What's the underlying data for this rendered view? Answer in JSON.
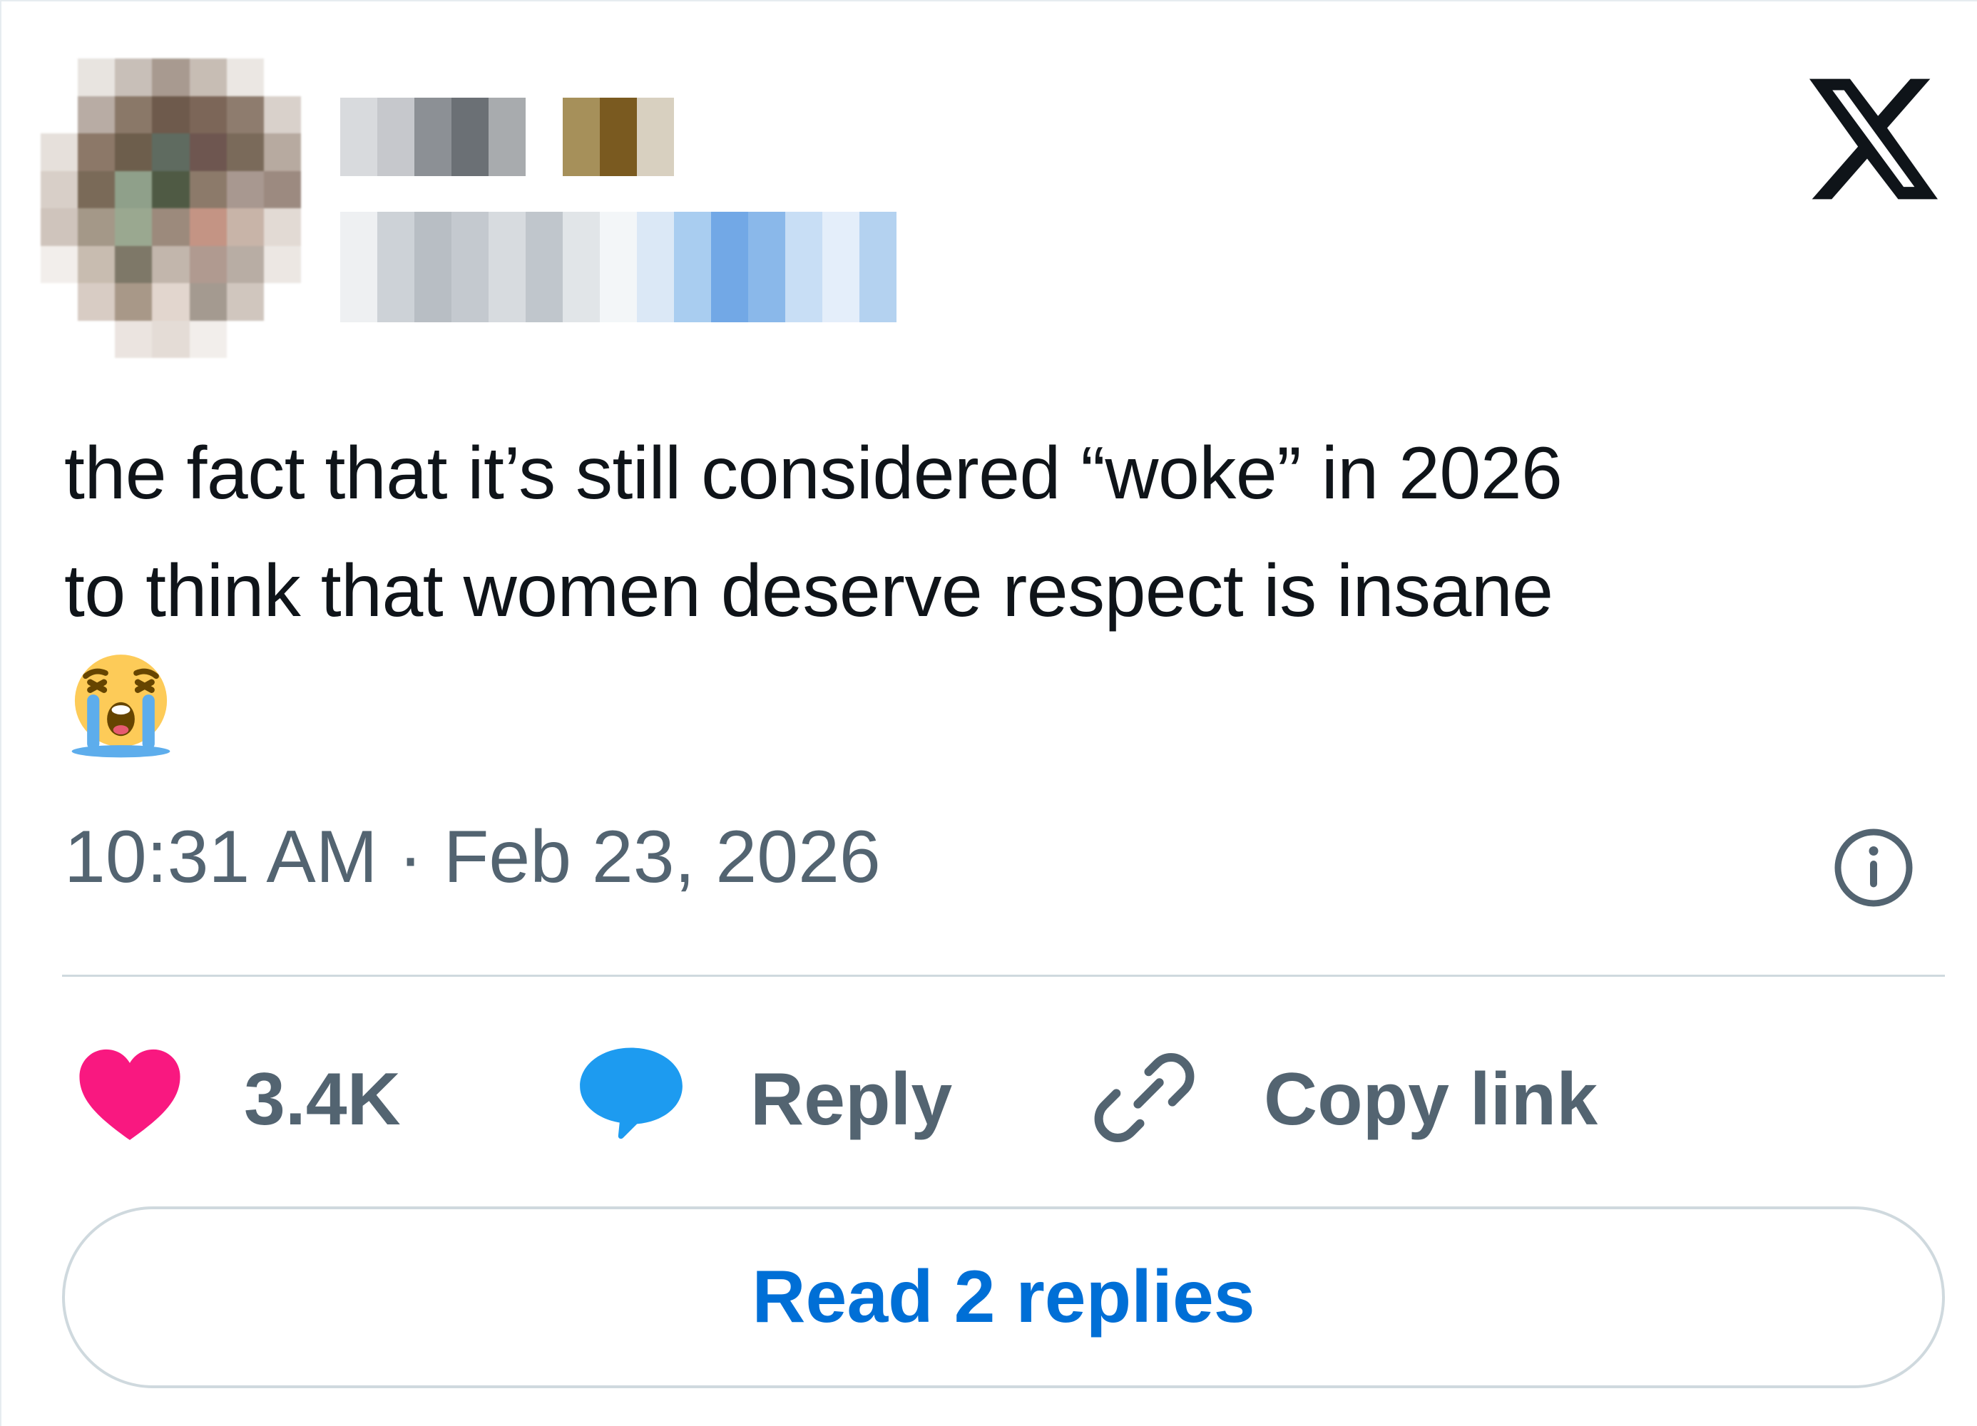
{
  "author": {
    "avatar_colors": [
      "#ffffff",
      "#e8e4e0",
      "#c8bfb8",
      "#a89a90",
      "#c7bdb4",
      "#ebe7e3",
      "#ffffff",
      "#ffffff",
      "#b8aca4",
      "#8a7868",
      "#6e5a4c",
      "#7c6658",
      "#8e7c6e",
      "#d9d1cb",
      "#e6e0db",
      "#8c7868",
      "#6d5e4c",
      "#5f6b60",
      "#6e5650",
      "#7a6a5a",
      "#b7aaa0",
      "#d8cfc8",
      "#7a6a58",
      "#8fa08a",
      "#4f5a44",
      "#8c7a6a",
      "#a89890",
      "#9c8a80",
      "#cfc4bc",
      "#a49888",
      "#9aa890",
      "#9c8a7c",
      "#c49484",
      "#c8b4a8",
      "#e2dad4",
      "#f2eeeb",
      "#c8bcb0",
      "#7e7868",
      "#c2b6ac",
      "#b09a90",
      "#b8ada4",
      "#ece7e3",
      "#ffffff",
      "#d8ccc4",
      "#a89888",
      "#e2d6ce",
      "#a49a90",
      "#d0c6be",
      "#ffffff",
      "#ffffff",
      "#ffffff",
      "#ebe4e0",
      "#e4dcd6",
      "#f2eeeb",
      "#ffffff",
      "#ffffff"
    ],
    "name_colors": [
      "#d8dadd",
      "#c6c8cc",
      "#8c9095",
      "#6b7075",
      "#a8abae",
      "#ffffff",
      "#a6905a",
      "#7a5a20",
      "#d8d0c0"
    ],
    "handle_colors": [
      "#eef0f2",
      "#cdd2d7",
      "#b8bec4",
      "#c4c9cf",
      "#d7dbdf",
      "#c0c6cc",
      "#e1e5e8",
      "#f3f6f8",
      "#dbe8f6",
      "#a9cdf0",
      "#72a8e6",
      "#8ab8ea",
      "#c8def5",
      "#e4eefa",
      "#b4d2f0"
    ]
  },
  "tweet": {
    "text": "the fact that it’s still considered “woke” in 2026\nto think that women deserve respect is insane",
    "emoji": "loudly-crying-face",
    "timestamp": "10:31 AM · Feb 23, 2026"
  },
  "actions": {
    "like_count": "3.4K",
    "reply_label": "Reply",
    "copy_link_label": "Copy link"
  },
  "read_replies_label": "Read 2 replies",
  "colors": {
    "like": "#f91880",
    "reply": "#1d9bf0",
    "secondary_text": "#536471",
    "link_button": "#006fd6",
    "border": "#cfd9de"
  }
}
